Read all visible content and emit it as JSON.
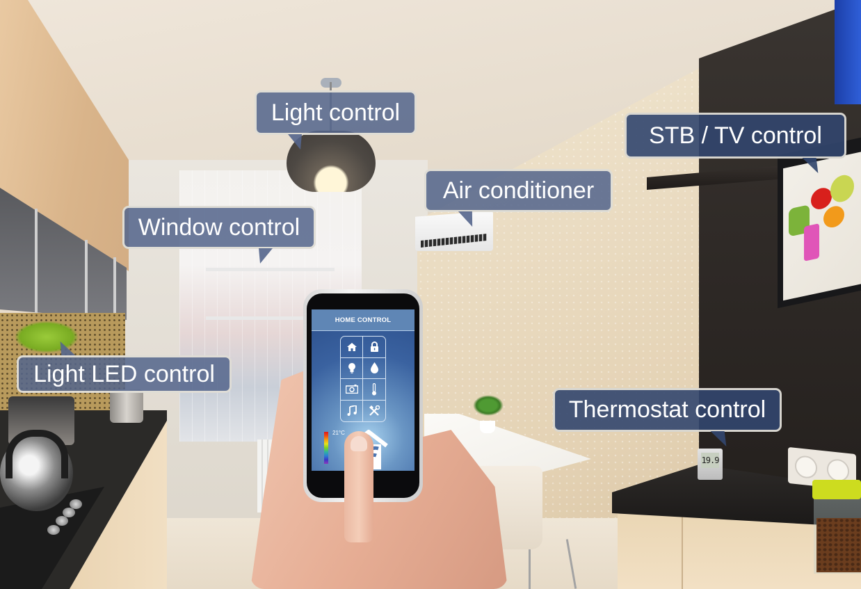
{
  "scene": {
    "description": "Smart home kitchen with callout labels and a smartphone home-control app"
  },
  "callouts": {
    "light": "Light control",
    "window": "Window control",
    "air_conditioner": "Air conditioner",
    "stb_tv": "STB / TV control",
    "light_led": "Light LED control",
    "thermostat": "Thermostat control"
  },
  "phone_app": {
    "title": "HOME CONTROL",
    "icons": [
      {
        "name": "home-icon",
        "glyph": "⌂"
      },
      {
        "name": "lock-icon",
        "glyph": "🔒"
      },
      {
        "name": "light-bulb-icon",
        "glyph": "💡"
      },
      {
        "name": "water-drop-icon",
        "glyph": "💧"
      },
      {
        "name": "camera-icon",
        "glyph": "📷"
      },
      {
        "name": "thermometer-icon",
        "glyph": "🌡"
      },
      {
        "name": "music-note-icon",
        "glyph": "♫"
      },
      {
        "name": "tools-icon",
        "glyph": "⚒"
      }
    ],
    "temperature": "21°C"
  },
  "thermostat_device": {
    "reading": "19.9"
  },
  "colors": {
    "callout_fill": "#54658c",
    "callout_border": "#f5eee1",
    "app_header": "#5f86b5",
    "app_background": "#3a62a0"
  }
}
